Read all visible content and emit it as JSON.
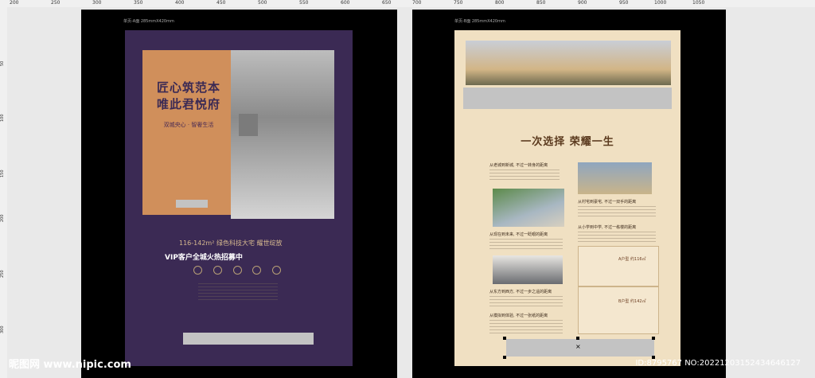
{
  "rulers": {
    "top_marks": [
      "200",
      "250",
      "300",
      "350",
      "400",
      "450",
      "500",
      "550",
      "600",
      "650",
      "700",
      "750",
      "800",
      "850",
      "900",
      "950",
      "1000",
      "1050"
    ],
    "left_marks": [
      "50",
      "100",
      "150",
      "200",
      "250",
      "300"
    ]
  },
  "artboards": {
    "left_label": "单页-A面  285mmX420mm",
    "right_label": "单页-B面  285mmX420mm"
  },
  "left_page": {
    "title_line1": "匠心筑范本",
    "title_line2": "唯此君悦府",
    "subtitle": "双城央心 · 智奢生活",
    "promo_line1": "116-142m² 绿色科技大宅  耀世绽放",
    "promo_line2": "VIP客户全城火热招募中"
  },
  "right_page": {
    "heading": "一次选择 荣耀一生",
    "sections": [
      "从老城到新城, 不过一转身的距离",
      "从村宅到豪宅, 不过一双手的距离",
      "从现在到未来, 不过一眨眼的距离",
      "从小学到中学, 不过一栋楼的距离",
      "从东方到西方, 不过一步之遥的距离",
      "从模拟到体验, 不过一张纸的距离"
    ],
    "plan_labels": [
      "A户型 约116㎡",
      "B户型 约142㎡"
    ]
  },
  "watermark": {
    "left": "昵图网 www.nipic.com",
    "right": "ID:8795767 NO:20221203152434646127"
  },
  "colors": {
    "left_bg": "#3b2a54",
    "right_bg": "#f0e0c2",
    "orange_panel": "#d08f5b",
    "accent_gold": "#d7b98f"
  }
}
